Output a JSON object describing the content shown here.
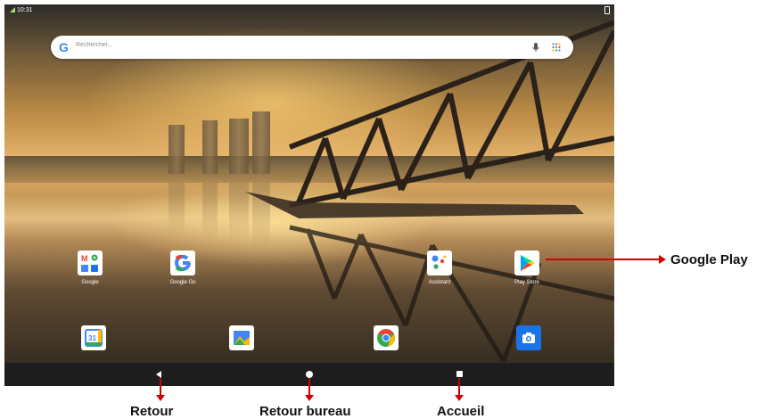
{
  "status_bar": {
    "time": "10:31"
  },
  "search": {
    "placeholder": "Rechercher..."
  },
  "apps": [
    {
      "label": "Google"
    },
    {
      "label": "Google Go"
    },
    {
      "label": "Assistant"
    },
    {
      "label": "Play Store"
    }
  ],
  "dock": [
    {
      "icon": "calendar-icon",
      "text": "31"
    },
    {
      "icon": "gallery-icon"
    },
    {
      "icon": "chrome-icon"
    },
    {
      "icon": "camera-icon"
    }
  ],
  "annotations": {
    "google_play": "Google Play",
    "retour": "Retour",
    "retour_bureau": "Retour bureau",
    "accueil": "Accueil"
  },
  "colors": {
    "arrow": "#d10000",
    "navbar": "#1d1d1d"
  }
}
